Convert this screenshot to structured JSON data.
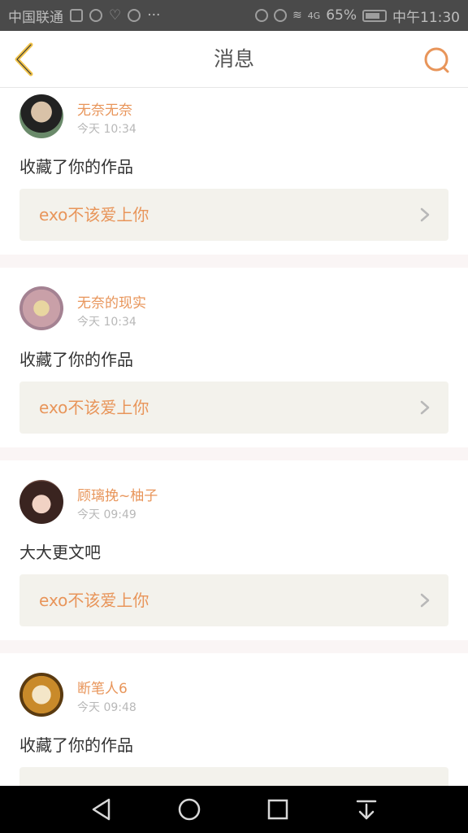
{
  "status_bar": {
    "carrier": "中国联通",
    "network": "4G",
    "battery": "65%",
    "time": "中午11:30"
  },
  "header": {
    "title": "消息",
    "back_icon": "chevron-left-icon",
    "search_icon": "search-icon"
  },
  "colors": {
    "accent": "#e8955a",
    "back_arrow": "#f2c44a",
    "card_link_bg": "#f3f2ec"
  },
  "messages": [
    {
      "username": "无奈无奈",
      "time": "今天 10:34",
      "content": "收藏了你的作品",
      "work_title": "exo不该爱上你"
    },
    {
      "username": "无奈的现实",
      "time": "今天 10:34",
      "content": "收藏了你的作品",
      "work_title": "exo不该爱上你"
    },
    {
      "username": "顾璃挽~柚子",
      "time": "今天 09:49",
      "content": "大大更文吧",
      "work_title": "exo不该爱上你"
    },
    {
      "username": "断笔人6",
      "time": "今天 09:48",
      "content": "收藏了你的作品",
      "work_title": ""
    }
  ],
  "nav_bar": {
    "back": "back-triangle-icon",
    "home": "home-circle-icon",
    "recents": "recents-square-icon",
    "notifications": "pull-down-icon"
  }
}
